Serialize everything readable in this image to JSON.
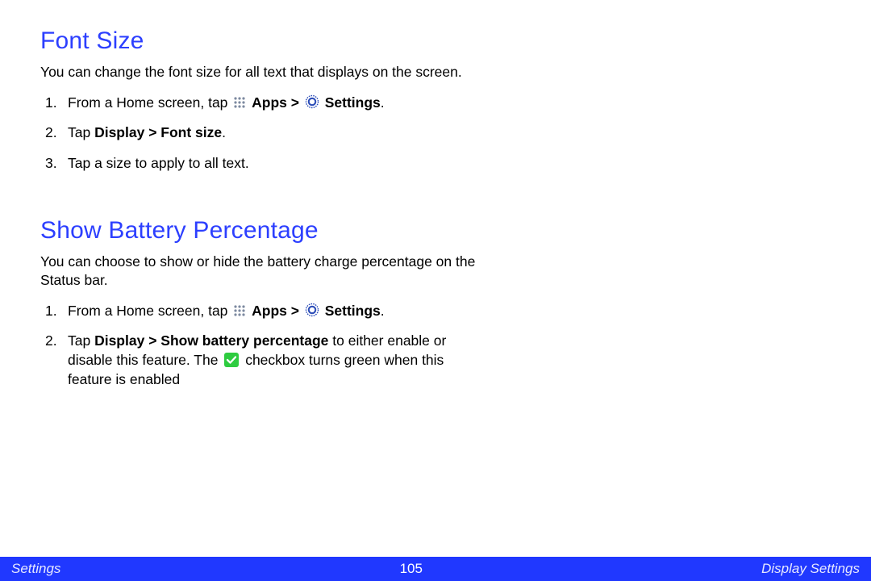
{
  "section1": {
    "heading": "Font Size",
    "intro": "You can change the font size for all text that displays on the screen.",
    "steps": {
      "s1_prefix": "From a Home screen, tap ",
      "apps_label": "Apps",
      "gt": " > ",
      "settings_label": "Settings",
      "period": ".",
      "s2_prefix": "Tap ",
      "s2_bold": "Display > Font size",
      "s3": "Tap a size to apply to all text."
    }
  },
  "section2": {
    "heading": "Show Battery Percentage",
    "intro": "You can choose to show or hide the battery charge percentage on the Status bar.",
    "steps": {
      "s1_prefix": "From a Home screen, tap ",
      "apps_label": "Apps",
      "gt": " > ",
      "settings_label": "Settings",
      "period": ".",
      "s2_prefix": "Tap ",
      "s2_bold": "Display > Show battery percentage",
      "s2_mid": " to either enable or disable this feature. The ",
      "s2_tail": " checkbox turns green when this feature is enabled"
    }
  },
  "footer": {
    "left": "Settings",
    "page": "105",
    "right": "Display Settings"
  }
}
